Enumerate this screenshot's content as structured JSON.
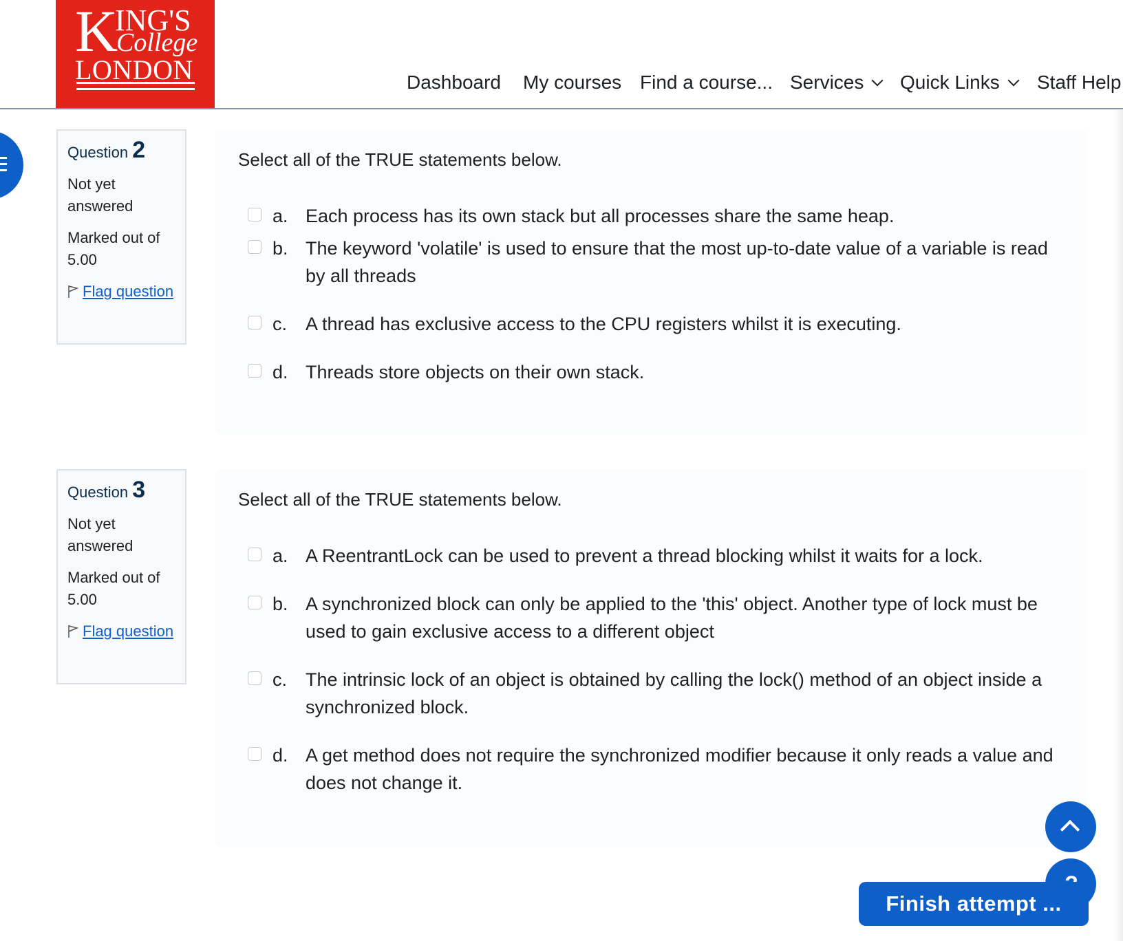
{
  "logo": {
    "line1": "KING'S",
    "line2": "College",
    "line3": "LONDON"
  },
  "nav": {
    "items": [
      {
        "label": "Dashboard"
      },
      {
        "label": "My courses"
      },
      {
        "label": "Find a course..."
      },
      {
        "label": "Services",
        "dropdown": true
      },
      {
        "label": "Quick Links",
        "dropdown": true
      },
      {
        "label": "Staff Help"
      }
    ]
  },
  "questions": [
    {
      "label": "Question",
      "number": "2",
      "state": "Not yet answered",
      "marks": "Marked out of 5.00",
      "flag_label": "Flag question",
      "prompt": "Select all of the TRUE statements below.",
      "options": [
        {
          "letter": "a.",
          "text": "Each process has its own stack but all processes share the same heap."
        },
        {
          "letter": "b.",
          "text": "The keyword 'volatile' is used to ensure that the most up-to-date value of a variable is read by all threads"
        },
        {
          "letter": "c.",
          "text": "A thread has exclusive access to the CPU registers whilst it is executing."
        },
        {
          "letter": "d.",
          "text": "Threads store objects on their own stack."
        }
      ]
    },
    {
      "label": "Question",
      "number": "3",
      "state": "Not yet answered",
      "marks": "Marked out of 5.00",
      "flag_label": "Flag question",
      "prompt": "Select all of the TRUE statements below.",
      "options": [
        {
          "letter": "a.",
          "text": "A ReentrantLock can be used to prevent a thread blocking whilst it waits for a lock."
        },
        {
          "letter": "b.",
          "text": "A synchronized block can only be applied to the 'this' object. Another type of lock must be used to gain exclusive access to a different object"
        },
        {
          "letter": "c.",
          "text": "The intrinsic lock of an object is obtained by calling the lock() method of an object inside a synchronized block."
        },
        {
          "letter": "d.",
          "text": "A get method does not require the synchronized modifier because it only reads a value and does not change it."
        }
      ]
    }
  ],
  "buttons": {
    "finish": "Finish attempt ...",
    "help": "?"
  },
  "colors": {
    "brand_red": "#e2231a",
    "accent_blue": "#0f5fc9"
  }
}
